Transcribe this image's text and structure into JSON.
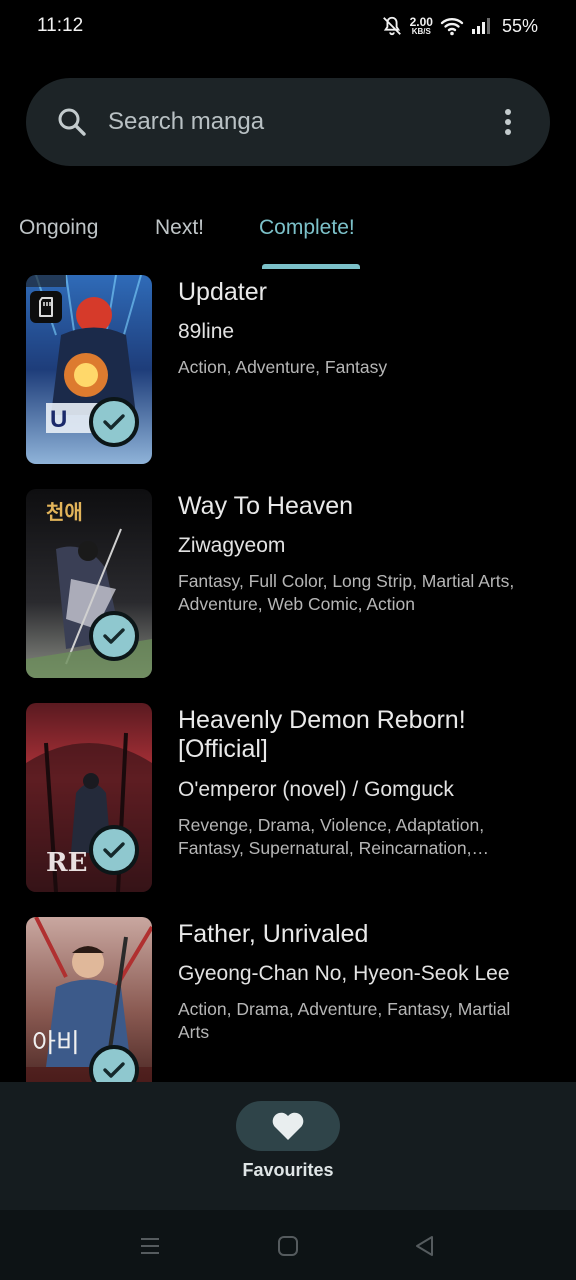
{
  "status": {
    "time": "11:12",
    "net_speed": "2.00",
    "net_unit": "KB/S",
    "battery": "55%"
  },
  "search": {
    "placeholder": "Search manga"
  },
  "tabs": [
    {
      "label": "Ongoing",
      "active": false
    },
    {
      "label": "Next!",
      "active": false
    },
    {
      "label": "Complete!",
      "active": true
    }
  ],
  "manga": [
    {
      "title": "Updater",
      "author": "89line",
      "genres": "Action, Adventure, Fantasy",
      "completed": true,
      "downloaded": true
    },
    {
      "title": "Way To Heaven",
      "author": "Ziwagyeom",
      "genres": "Fantasy, Full Color, Long Strip, Martial Arts, Adventure, Web Comic, Action",
      "completed": true,
      "downloaded": false
    },
    {
      "title": "Heavenly Demon Reborn! [Official]",
      "author": "O'emperor (novel) / Gomguck",
      "genres": "Revenge, Drama, Violence, Adaptation, Fantasy, Supernatural, Reincarnation,…",
      "completed": true,
      "downloaded": false
    },
    {
      "title": "Father, Unrivaled",
      "author": "Gyeong-Chan No, Hyeon-Seok Lee",
      "genres": "Action, Drama, Adventure, Fantasy, Martial Arts",
      "completed": true,
      "downloaded": false
    }
  ],
  "bottom_nav": {
    "label": "Favourites",
    "icon": "heart-icon"
  },
  "colors": {
    "accent": "#7cc1c9",
    "background": "#000000",
    "search_bg": "#1d2427",
    "nav_bg": "#151c1f",
    "nav_pill": "#2f4449"
  }
}
